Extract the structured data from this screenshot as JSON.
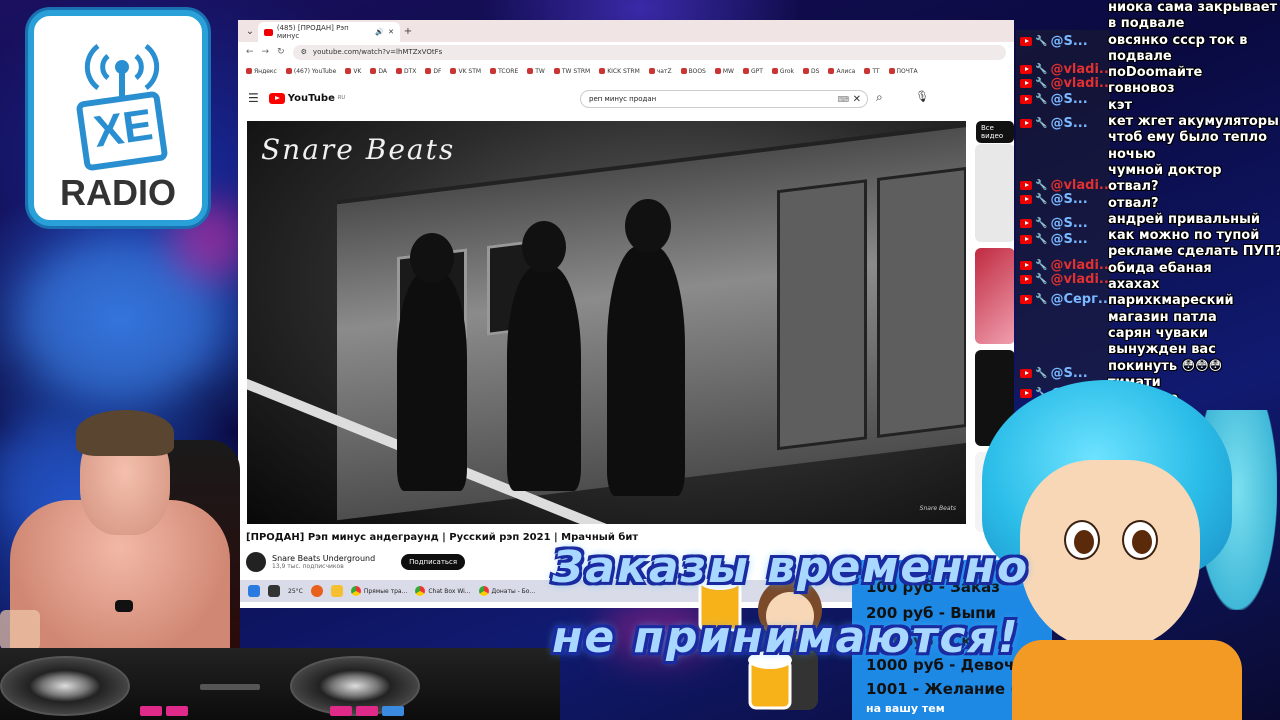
{
  "logo": {
    "main": "XE",
    "sub": "RADIO"
  },
  "browser": {
    "tab_title": "(485) [ПРОДАН] Рэп минус",
    "url": "youtube.com/watch?v=lhMTZxVOtFs",
    "bookmarks": [
      "Яндекс",
      "(467) YouTube",
      "VK",
      "DA",
      "DTX",
      "DF",
      "VK STM",
      "TCORE",
      "TW",
      "TW STRM",
      "KICK STRM",
      "чатZ",
      "BOOS",
      "MW",
      "GPT",
      "Grok",
      "DS",
      "Алиса",
      "TT",
      "ПОЧТА"
    ],
    "youtube_label": "YouTube",
    "youtube_region": "RU",
    "search_query": "реп минус продан",
    "video_brand": "Snare Beats",
    "video_title": "[ПРОДАН] Рэп минус андеграунд | Русский рэп 2021 | Мрачный бит",
    "channel_name": "Snare Beats Underground",
    "channel_subs": "13,9 тыс. подписчиков",
    "subscribe": "Подписаться",
    "side_filter": "Все видео"
  },
  "taskbar": {
    "temp": "25°C",
    "items": [
      "Прямые тра...",
      "Chat Box Wi...",
      "Донаты - Бо..."
    ]
  },
  "chat": {
    "names": [
      "@S...",
      "@vladi...",
      "@vladi...",
      "@S...",
      "@S...",
      "@vladi...",
      "@S...",
      "@S...",
      "@S...",
      "@vladi...",
      "@vladi...",
      "@Серг...",
      "@S...",
      "@S..."
    ],
    "lines": [
      "ниока сама закрывает",
      "в подвале",
      "овсянко ссср ток в",
      "подвале",
      "поDoomайте",
      "говновоз",
      "кэт",
      "кет жгет акумуляторы",
      "чтоб ему было тепло",
      "ночью",
      "чумной доктор",
      "отвал?",
      "отвал?",
      "андрей привальный",
      "как можно по тупой",
      "рекламе сделать ПУП?",
      "обида ебаная",
      "ахахах",
      "парихкмареский",
      "магазин патла",
      "сарян чуваки",
      "вынужден вас",
      "покинуть 😳😳😳",
      "тимати",
      "написано"
    ]
  },
  "overlay": {
    "line1": "Заказы временно",
    "line2": "не принимаются!"
  },
  "price_list": [
    "100 руб - Заказ",
    "200 руб - Выпи",
    "500 руб - Ск",
    "1000 руб - Девочк",
    "1001 - Желание (",
    "на вашу тем"
  ],
  "colors": {
    "youtube_red": "#ff0000",
    "overlay_text": "#a8d8ff",
    "overlay_outline": "#1a2aa0",
    "price_bg": "#1e88e5",
    "chat_name": "#7ab8ff"
  }
}
